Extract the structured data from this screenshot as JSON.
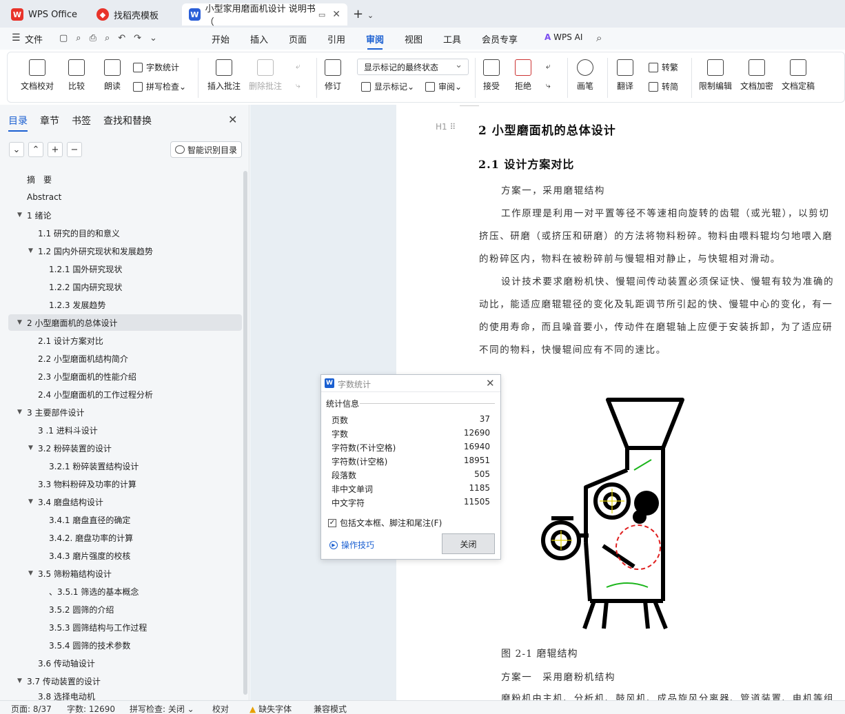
{
  "tabs": [
    {
      "label": "WPS Office",
      "icon": "wps-logo-icon"
    },
    {
      "label": "找稻壳模板",
      "icon": "docer-icon"
    },
    {
      "label": "小型家用磨面机设计 说明书（",
      "icon": "word-doc-icon"
    }
  ],
  "menu": [
    "文件",
    "开始",
    "插入",
    "页面",
    "引用",
    "审阅",
    "视图",
    "工具",
    "会员专享",
    "WPS AI"
  ],
  "ribbon": {
    "doc_check": "文档校对",
    "compare": "比较",
    "read_aloud": "朗读",
    "word_count": "字数统计",
    "spell_check": "拼写检查",
    "insert_comment": "插入批注",
    "delete_comment": "删除批注",
    "revise": "修订",
    "markup_state": "显示标记的最终状态",
    "show_markup": "显示标记",
    "review": "审阅",
    "accept": "接受",
    "reject": "拒绝",
    "pen": "画笔",
    "translate": "翻译",
    "to_traditional": "转繁",
    "to_simplified": "转简",
    "restrict_edit": "限制编辑",
    "encrypt": "文档加密",
    "finalize": "文档定稿"
  },
  "nav": {
    "tabs": [
      "目录",
      "章节",
      "书签",
      "查找和替换"
    ],
    "smart_toc": "智能识别目录",
    "toc": [
      {
        "label": "摘　要"
      },
      {
        "label": "Abstract"
      },
      {
        "label": "1  绪论"
      },
      {
        "label": "1.1  研究的目的和意义"
      },
      {
        "label": "1.2  国内外研究现状和发展趋势"
      },
      {
        "label": "1.2.1 国外研究现状"
      },
      {
        "label": "1.2.2 国内研究现状"
      },
      {
        "label": "1.2.3  发展趋势"
      },
      {
        "label": "2  小型磨面机的总体设计"
      },
      {
        "label": "2.1 设计方案对比"
      },
      {
        "label": "2.2  小型磨面机结构简介"
      },
      {
        "label": "2.3 小型磨面机的性能介绍"
      },
      {
        "label": "2.4  小型磨面机的工作过程分析"
      },
      {
        "label": "3 主要部件设计"
      },
      {
        "label": "3 .1  进料斗设计"
      },
      {
        "label": "3.2 粉碎装置的设计"
      },
      {
        "label": "3.2.1  粉碎装置结构设计"
      },
      {
        "label": "3.3  物料粉碎及功率的计算"
      },
      {
        "label": "3.4  磨盘结构设计"
      },
      {
        "label": "3.4.1  磨盘直径的确定"
      },
      {
        "label": "3.4.2.  磨盘功率的计算"
      },
      {
        "label": "3.4.3 磨片强度的校核"
      },
      {
        "label": "3.5  筛粉箱结构设计"
      },
      {
        "label": "、3.5.1  筛选的基本概念"
      },
      {
        "label": "3.5.2 圆筛的介绍"
      },
      {
        "label": "3.5.3  圆筛结构与工作过程"
      },
      {
        "label": "3.5.4  圆筛的技术参数"
      },
      {
        "label": "3.6  传动轴设计"
      },
      {
        "label": "3.7  传动装置的设计"
      },
      {
        "label": "3.8  选择电动机"
      }
    ]
  },
  "document": {
    "heading_marker": "H1",
    "h1": "2  小型磨面机的总体设计",
    "h2": "2.1 设计方案对比",
    "paragraphs": [
      "方案一，采用磨辊结构",
      "工作原理是利用一对平置等径不等速相向旋转的齿辊（或光辊），以剪切",
      "挤压、研磨（或挤压和研磨）的方法将物料粉碎。物料由喂料辊均匀地喂入磨",
      "的粉碎区内，物料在被粉碎前与慢辊相对静止，与快辊相对滑动。",
      "设计技术要求磨粉机快、慢辊间传动装置必须保证快、慢辊有较为准确的",
      "动比，能适应磨辊辊径的变化及轧距调节所引起的快、慢辊中心的变化，有一",
      "的使用寿命，而且噪音要小，传动件在磨辊轴上应便于安装拆卸，为了适应研",
      "不同的物料，快慢辊间应有不同的速比。"
    ],
    "figure_caption": "图 2-1 磨辊结构",
    "after_para_1": "方案一　采用磨粉机结构",
    "after_para_2": "磨粉机由主机、分析机、鼓风机、成品旋风分离器、管道装置、电机等组"
  },
  "dialog": {
    "title": "字数统计",
    "section": "统计信息",
    "stats": [
      {
        "label": "页数",
        "value": "37"
      },
      {
        "label": "字数",
        "value": "12690"
      },
      {
        "label": "字符数(不计空格)",
        "value": "16940"
      },
      {
        "label": "字符数(计空格)",
        "value": "18951"
      },
      {
        "label": "段落数",
        "value": "505"
      },
      {
        "label": "非中文单词",
        "value": "1185"
      },
      {
        "label": "中文字符",
        "value": "11505"
      }
    ],
    "checkbox_label": "包括文本框、脚注和尾注(F)",
    "tips": "操作技巧",
    "close": "关闭"
  },
  "status": {
    "page": "页面: 8/37",
    "words": "字数: 12690",
    "spell": "拼写检查: 关闭",
    "proof": "校对",
    "missing_font": "缺失字体",
    "compat": "兼容模式"
  },
  "colors": {
    "accent": "#1a5fd1",
    "wps_red": "#e8332a"
  }
}
